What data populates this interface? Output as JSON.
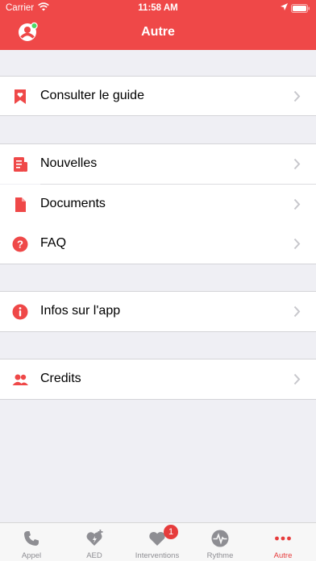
{
  "status_bar": {
    "carrier": "Carrier",
    "time": "11:58 AM"
  },
  "header": {
    "title": "Autre"
  },
  "menu": {
    "guide": "Consulter le guide",
    "news": "Nouvelles",
    "documents": "Documents",
    "faq": "FAQ",
    "app_info": "Infos sur l'app",
    "credits": "Credits"
  },
  "tabs": [
    {
      "label": "Appel",
      "icon": "phone-icon"
    },
    {
      "label": "AED",
      "icon": "aed-heart-icon"
    },
    {
      "label": "Interventions",
      "icon": "heart-icon",
      "badge": "1"
    },
    {
      "label": "Rythme",
      "icon": "heartbeat-icon"
    },
    {
      "label": "Autre",
      "icon": "more-dots-icon",
      "active": true
    }
  ],
  "colors": {
    "accent": "#ef4848",
    "tab_active": "#e63c3c",
    "tab_inactive": "#8e8e93",
    "online_dot": "#4cd964"
  }
}
